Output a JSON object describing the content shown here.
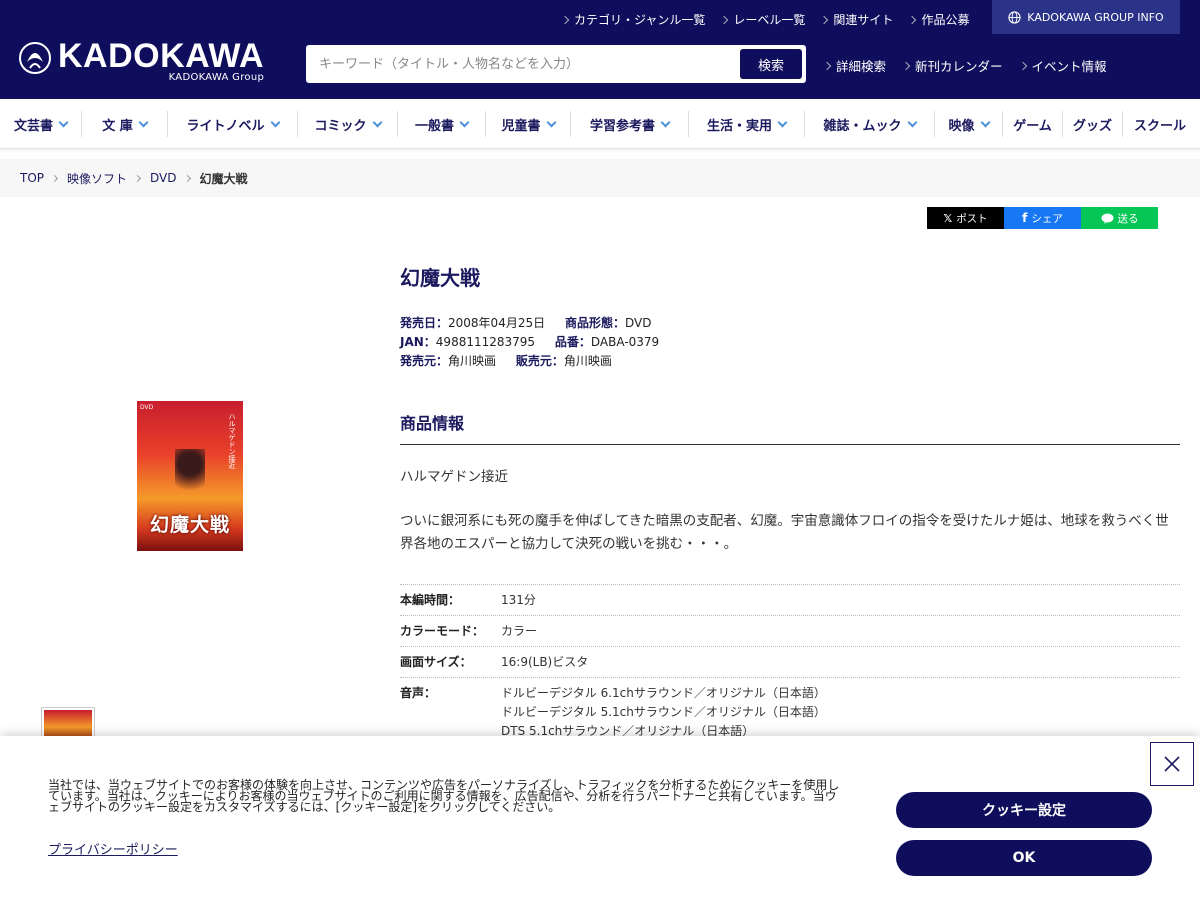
{
  "colors": {
    "header_bg": "#0f0e5c",
    "accent_blue": "#4a90d9",
    "rainbow": [
      "#e8546a",
      "#f29c3a",
      "#8fc43a",
      "#2bb58f",
      "#3a8fd9",
      "#4f5fd0",
      "#e0649a",
      "#ffcf3a",
      "#e8546a",
      "#7ac9e8"
    ]
  },
  "header": {
    "logo_text": "KADOKAWA",
    "logo_sub": "KADOKAWA Group",
    "top_links": [
      "カテゴリ・ジャンル一覧",
      "レーベル一覧",
      "関連サイト",
      "作品公募"
    ],
    "group_info": "KADOKAWA GROUP INFO",
    "search_placeholder": "キーワード（タイトル・人物名などを入力）",
    "search_button": "検索",
    "sub_links": [
      "詳細検索",
      "新刊カレンダー",
      "イベント情報"
    ]
  },
  "nav": {
    "categories": [
      {
        "label": "文芸書",
        "dropdown": true
      },
      {
        "label": "文 庫",
        "dropdown": true
      },
      {
        "label": "ライトノベル",
        "dropdown": true
      },
      {
        "label": "コミック",
        "dropdown": true
      },
      {
        "label": "一般書",
        "dropdown": true
      },
      {
        "label": "児童書",
        "dropdown": true
      },
      {
        "label": "学習参考書",
        "dropdown": true
      },
      {
        "label": "生活・実用",
        "dropdown": true
      },
      {
        "label": "雑誌・ムック",
        "dropdown": true
      },
      {
        "label": "映像",
        "dropdown": true
      },
      {
        "label": "ゲーム",
        "dropdown": false
      },
      {
        "label": "グッズ",
        "dropdown": false
      },
      {
        "label": "スクール",
        "dropdown": false
      }
    ]
  },
  "breadcrumb": {
    "items": [
      "TOP",
      "映像ソフト",
      "DVD"
    ],
    "current": "幻魔大戦"
  },
  "share": {
    "x": "ポスト",
    "facebook": "シェア",
    "line": "送る"
  },
  "product": {
    "cover_title": "幻魔大戦",
    "cover_badge": "DVD",
    "cover_vertical": "ハルマゲドン接近",
    "title": "幻魔大戦",
    "release_label": "発売日：",
    "release": "2008年04月25日",
    "format_label": "商品形態：",
    "format": "DVD",
    "jan_label": "JAN：",
    "jan": "4988111283795",
    "code_label": "品番：",
    "code": "DABA-0379",
    "publisher_label": "発売元：",
    "publisher": "角川映画",
    "seller_label": "販売元：",
    "seller": "角川映画",
    "section_title": "商品情報",
    "tagline": "ハルマゲドン接近",
    "description": "ついに銀河系にも死の魔手を伸ばしてきた暗黒の支配者、幻魔。宇宙意識体フロイの指令を受けたルナ姫は、地球を救うべく世界各地のエスパーと協力して決死の戦いを挑む・・・。",
    "specs": [
      {
        "key": "本編時間：",
        "values": [
          "131分"
        ]
      },
      {
        "key": "カラーモード：",
        "values": [
          "カラー"
        ]
      },
      {
        "key": "画面サイズ：",
        "values": [
          "16:9(LB)ビスタ"
        ]
      },
      {
        "key": "音声：",
        "values": [
          "ドルビーデジタル 6.1chサラウンド／オリジナル（日本語）",
          "ドルビーデジタル 5.1chサラウンド／オリジナル（日本語）",
          "DTS 5.1chサラウンド／オリジナル（日本語）"
        ]
      }
    ]
  },
  "cookie": {
    "text": "当社では、当ウェブサイトでのお客様の体験を向上させ、コンテンツや広告をパーソナライズし、トラフィックを分析するためにクッキーを使用しています。当社は、クッキーによりお客様の当ウェブサイトのご利用に関する情報を、広告配信や、分析を行うパートナーと共有しています。当ウェブサイトのクッキー設定をカスタマイズするには、[クッキー設定]をクリックしてください。",
    "privacy_link": "プライバシーポリシー",
    "settings_button": "クッキー設定",
    "ok_button": "OK"
  }
}
